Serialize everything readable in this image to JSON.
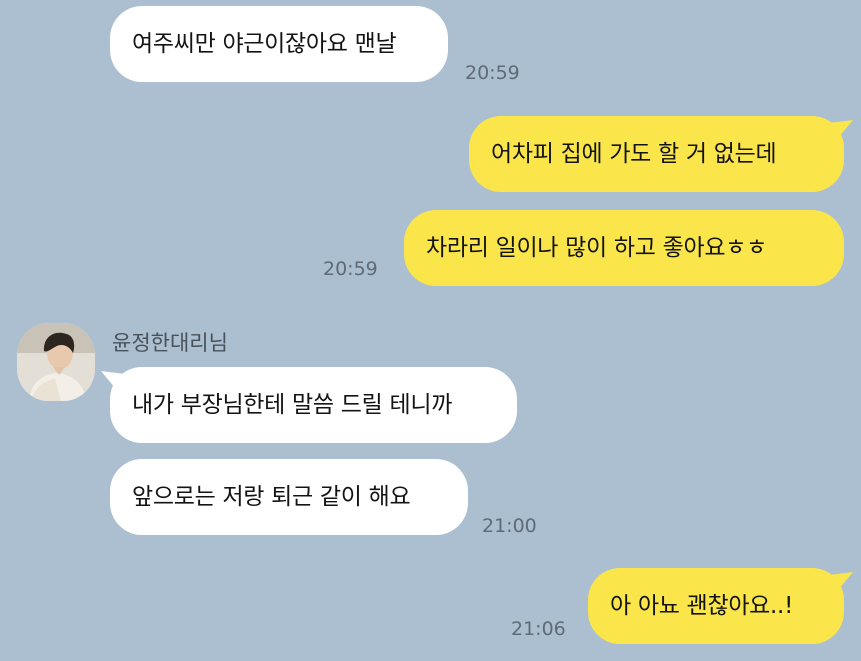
{
  "chat": {
    "sender_name": "윤정한대리님",
    "colors": {
      "background": "#abbfd0",
      "incoming_bubble": "#ffffff",
      "outgoing_bubble": "#fae64b",
      "timestamp_text": "#5f6b76"
    },
    "messages": [
      {
        "direction": "incoming",
        "text": "여주씨만 야근이잖아요 맨날",
        "time": "20:59"
      },
      {
        "direction": "outgoing",
        "text": "어차피 집에 가도 할 거 없는데",
        "time": ""
      },
      {
        "direction": "outgoing",
        "text": "차라리 일이나 많이 하고 좋아요ㅎㅎ",
        "time": "20:59"
      },
      {
        "direction": "incoming",
        "sender": "윤정한대리님",
        "text": "내가 부장님한테 말씀 드릴 테니까",
        "time": ""
      },
      {
        "direction": "incoming",
        "text": "앞으로는 저랑 퇴근 같이 해요",
        "time": "21:00"
      },
      {
        "direction": "outgoing",
        "text": "아 아뇨 괜찮아요..!",
        "time": "21:06"
      }
    ]
  }
}
